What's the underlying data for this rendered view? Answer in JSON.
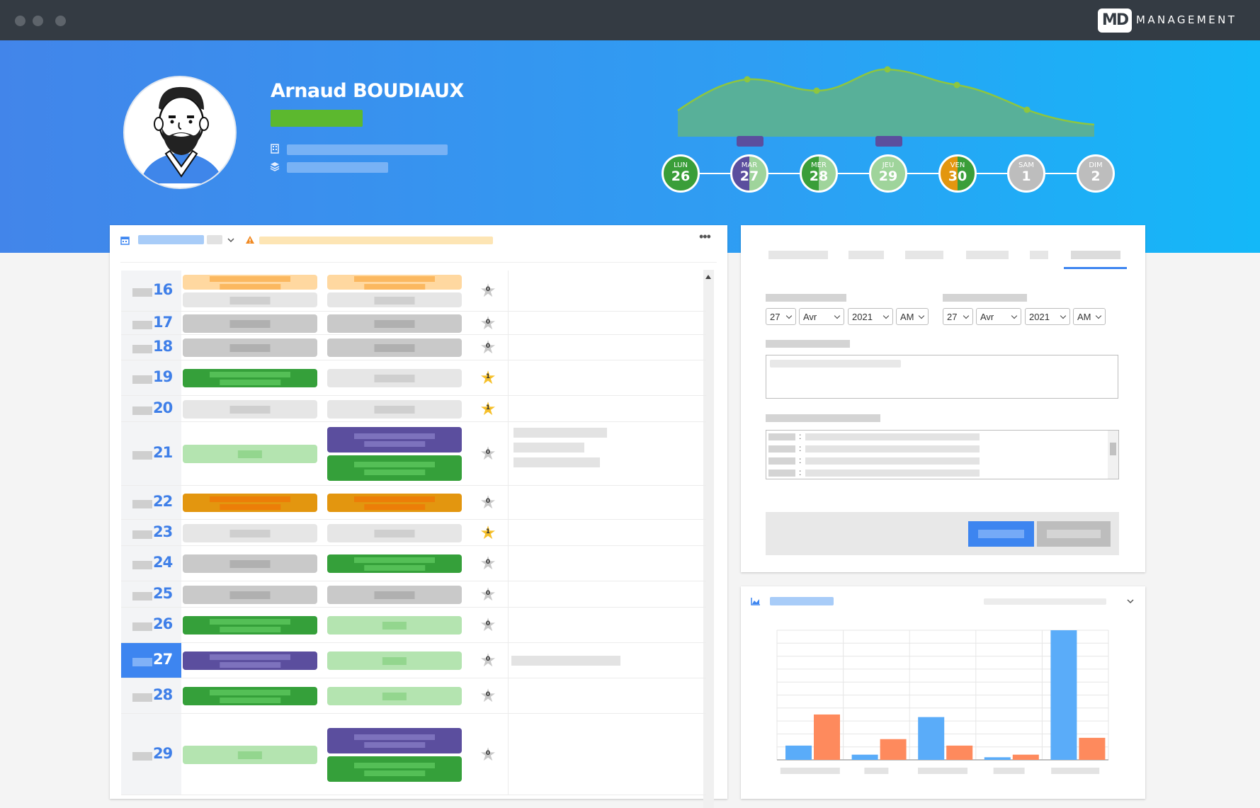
{
  "app": {
    "brand_logo": "MD",
    "brand_name": "MANAGEMENT"
  },
  "profile": {
    "name": "Arnaud BOUDIAUX",
    "status_color": "#5cb82e",
    "company_icon": "building-icon",
    "team_icon": "layers-icon"
  },
  "week": [
    {
      "name": "LUN",
      "day": "26",
      "color": "#3a9e39",
      "fill": "full"
    },
    {
      "name": "MAR",
      "day": "27",
      "color": "#5b4e9e",
      "fill": "half",
      "color2": "#9fd49b"
    },
    {
      "name": "MER",
      "day": "28",
      "color": "#3a9e39",
      "fill": "half",
      "color2": "#9fd49b"
    },
    {
      "name": "JEU",
      "day": "29",
      "color": "#9fd49b",
      "fill": "full"
    },
    {
      "name": "VEN",
      "day": "30",
      "color": "#e3960f",
      "fill": "half",
      "color2": "#3a9e39"
    },
    {
      "name": "SAM",
      "day": "1",
      "color": "#bdbdbd",
      "fill": "full"
    },
    {
      "name": "DIM",
      "day": "2",
      "color": "#bdbdbd",
      "fill": "full"
    }
  ],
  "calendar": {
    "icon": "calendar-icon",
    "warning_icon": "warning-icon",
    "menu_icon": "more-icon",
    "rows": [
      {
        "day": "16",
        "star": "0",
        "starred": false
      },
      {
        "day": "17",
        "star": "0",
        "starred": false
      },
      {
        "day": "18",
        "star": "0",
        "starred": false
      },
      {
        "day": "19",
        "star": "1",
        "starred": true
      },
      {
        "day": "20",
        "star": "1",
        "starred": true
      },
      {
        "day": "21",
        "star": "0",
        "starred": false
      },
      {
        "day": "22",
        "star": "0",
        "starred": false
      },
      {
        "day": "23",
        "star": "1",
        "starred": true
      },
      {
        "day": "24",
        "star": "0",
        "starred": false
      },
      {
        "day": "25",
        "star": "0",
        "starred": false
      },
      {
        "day": "26",
        "star": "0",
        "starred": false
      },
      {
        "day": "27",
        "star": "0",
        "starred": false,
        "current": true
      },
      {
        "day": "28",
        "star": "0",
        "starred": false
      },
      {
        "day": "29",
        "star": "0",
        "starred": false
      }
    ]
  },
  "form": {
    "start": {
      "day": "27",
      "month": "Avr",
      "year": "2021",
      "period": "AM"
    },
    "end": {
      "day": "27",
      "month": "Avr",
      "year": "2021",
      "period": "AM"
    },
    "separator": ":",
    "colors": {
      "primary": "#3d85f0",
      "secondary": "#bdbdbd"
    }
  },
  "chart_panel": {
    "icon": "area-chart-icon"
  },
  "chart_data": {
    "type": "bar",
    "categories": [
      "",
      "",
      "",
      "",
      ""
    ],
    "series": [
      {
        "color": "#5aacf9",
        "values": [
          11,
          4,
          33,
          2,
          100
        ]
      },
      {
        "color": "#fe8a5d",
        "values": [
          35,
          16,
          11,
          4,
          17
        ]
      }
    ],
    "ylim": [
      0,
      100
    ],
    "grid": true
  }
}
